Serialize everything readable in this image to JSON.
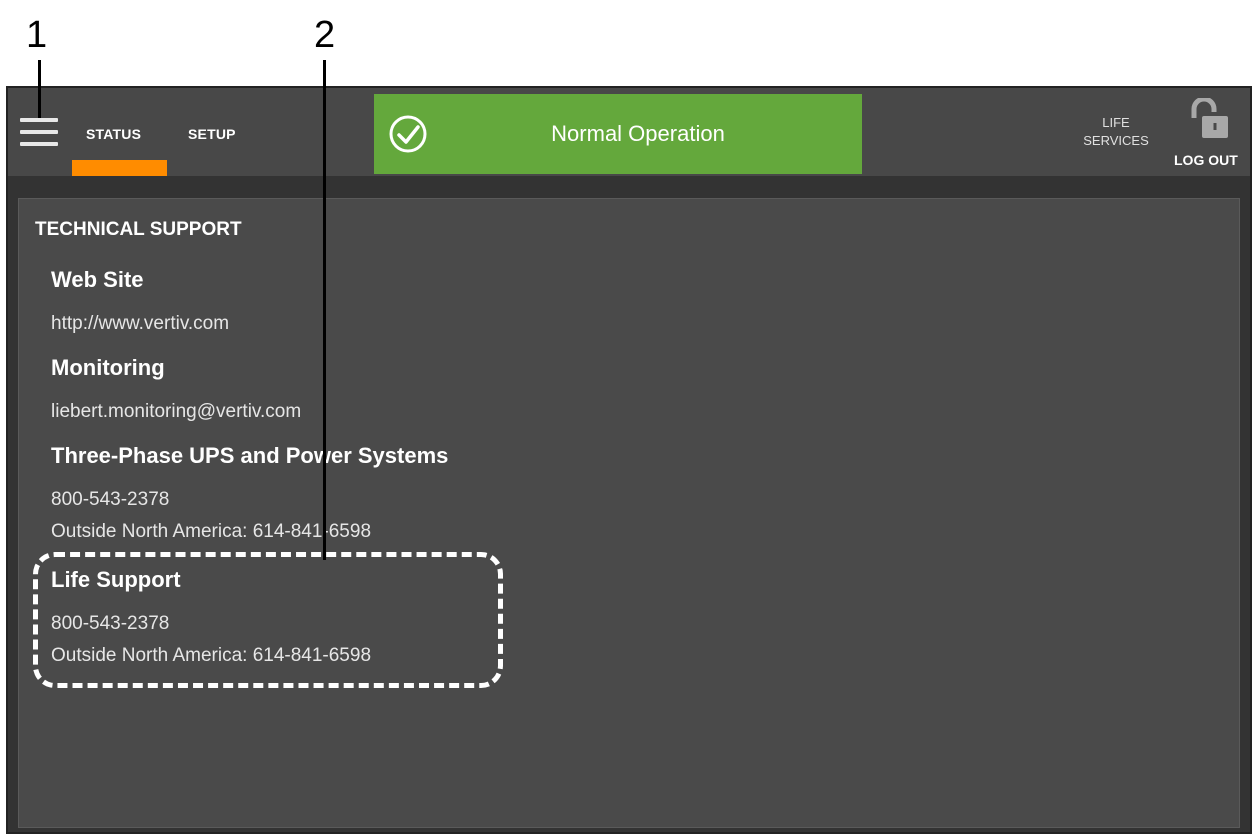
{
  "callouts": {
    "one": "1",
    "two": "2"
  },
  "topbar": {
    "tabs": [
      {
        "label": "STATUS",
        "active": true
      },
      {
        "label": "SETUP",
        "active": false
      }
    ],
    "status": {
      "text": "Normal Operation",
      "color": "#64a83c"
    },
    "life_services": {
      "line1": "LIFE",
      "line2": "SERVICES"
    },
    "logout": "LOG OUT",
    "accent_color": "#ff8c00"
  },
  "content": {
    "title": "TECHNICAL SUPPORT",
    "website_heading": "Web Site",
    "website_value": "http://www.vertiv.com",
    "monitoring_heading": "Monitoring",
    "monitoring_value": "liebert.monitoring@vertiv.com",
    "three_phase_heading": "Three-Phase UPS and Power Systems",
    "three_phase_phone": "800-543-2378",
    "three_phase_intl": "Outside North America: 614-841-6598",
    "life_support_heading": "Life Support",
    "life_support_phone": "800-543-2378",
    "life_support_intl": "Outside North America: 614-841-6598"
  }
}
